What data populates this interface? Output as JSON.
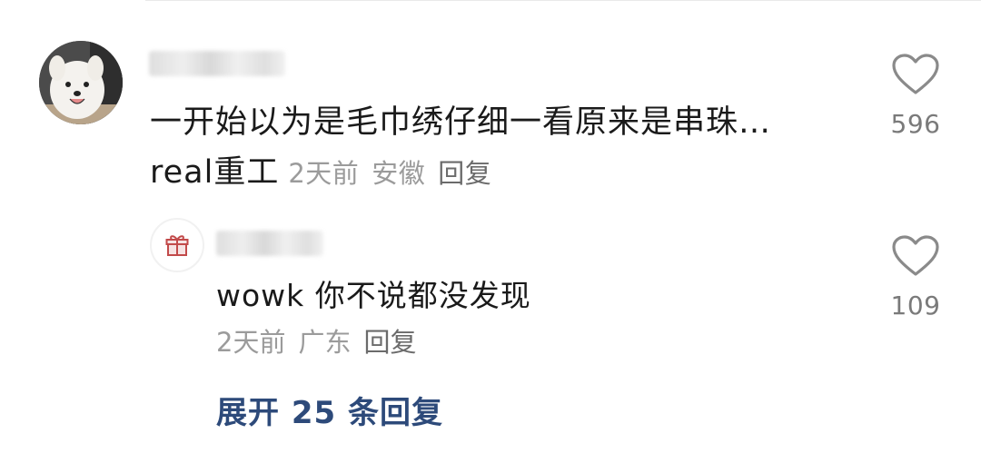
{
  "comment": {
    "avatar_icon": "samoyed-dog-avatar",
    "text": "一开始以为是毛巾绣仔细一看原来是串珠…real重工",
    "time": "2天前",
    "location": "安徽",
    "reply_label": "回复",
    "like_icon": "heart-outline-icon",
    "like_count": "596"
  },
  "reply": {
    "avatar_icon": "gift-icon",
    "text": "wowk 你不说都没发现",
    "time": "2天前",
    "location": "广东",
    "reply_label": "回复",
    "like_icon": "heart-outline-icon",
    "like_count": "109"
  },
  "expand_label": "展开 25 条回复",
  "colors": {
    "text": "#1a1a1a",
    "meta": "#9b9b9b",
    "link": "#2d4a7a",
    "heart": "#8a8a8a"
  }
}
